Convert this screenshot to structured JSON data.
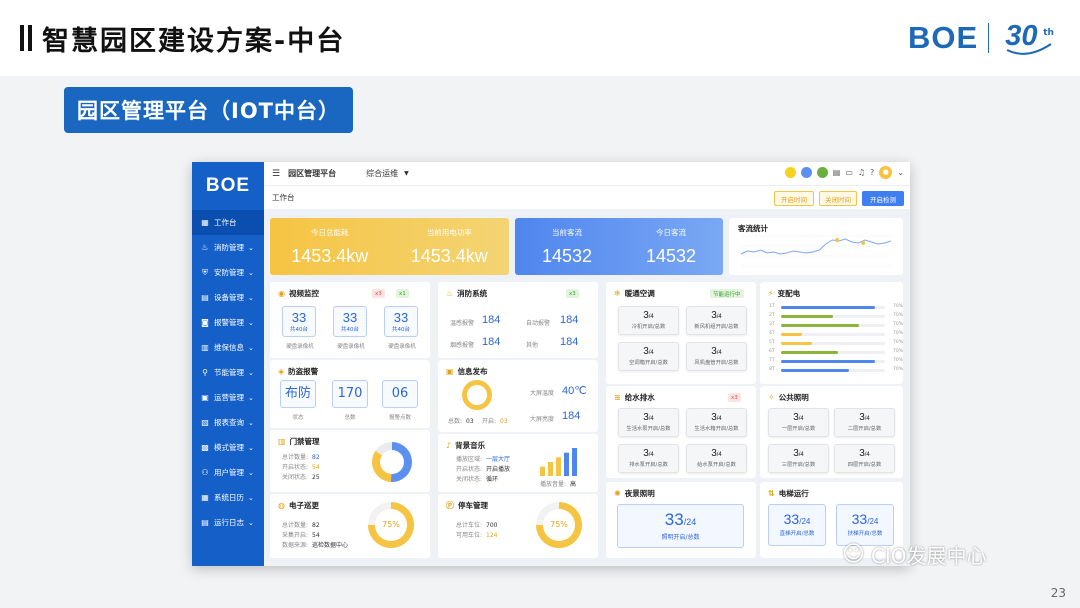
{
  "slide": {
    "title": "智慧园区建设方案-中台",
    "brand": "BOE",
    "anniversary": {
      "number": "30",
      "suffix": "th"
    },
    "section_tag": "园区管理平台（IOT中台）",
    "page_number": "23",
    "watermark": "CIO发展中心"
  },
  "colors": {
    "primary": "#1560c8",
    "accent_yellow": "#f6c443",
    "accent_blue": "#4f86ee",
    "value_blue": "#2c66d8",
    "green": "#8bb43a",
    "gray_donut": "#9aa4b8"
  },
  "sidebar": {
    "logo": "BOE",
    "items": [
      {
        "label": "工作台",
        "icon": "workbench-icon",
        "active": true,
        "chev": false
      },
      {
        "label": "消防管理",
        "icon": "fire-icon",
        "chev": true
      },
      {
        "label": "安防管理",
        "icon": "shield-icon",
        "chev": true
      },
      {
        "label": "设备管理",
        "icon": "device-icon",
        "chev": true
      },
      {
        "label": "报警管理",
        "icon": "alarm-icon",
        "chev": true
      },
      {
        "label": "维保信息",
        "icon": "maintenance-icon",
        "chev": true
      },
      {
        "label": "节能管理",
        "icon": "energy-icon",
        "chev": true
      },
      {
        "label": "运营管理",
        "icon": "operation-icon",
        "chev": true
      },
      {
        "label": "报表查询",
        "icon": "report-icon",
        "chev": true
      },
      {
        "label": "模式管理",
        "icon": "mode-icon",
        "chev": true
      },
      {
        "label": "用户管理",
        "icon": "user-icon",
        "chev": true
      },
      {
        "label": "系统日历",
        "icon": "calendar-icon",
        "chev": true
      },
      {
        "label": "运行日志",
        "icon": "log-icon",
        "chev": true
      }
    ]
  },
  "topbar": {
    "menu_icon": "menu-icon",
    "platform": "园区管理平台",
    "ops": "综合运维",
    "status_dots": [
      "#f6d21e",
      "#5b8ff0",
      "#6ab03f"
    ],
    "icons": [
      "doc-icon",
      "message-icon",
      "bell-icon",
      "help-icon",
      "avatar-icon"
    ]
  },
  "crumb": {
    "label": "工作台",
    "buttons": {
      "start_time": "开启时间",
      "close_time": "关闭时间",
      "start_check": "开启检测"
    }
  },
  "kpi": {
    "energy": [
      {
        "label": "今日总能耗",
        "value": "1453.4kw"
      },
      {
        "label": "当前用电功率",
        "value": "1453.4kw"
      }
    ],
    "flow": [
      {
        "label": "当前客流",
        "value": "14532"
      },
      {
        "label": "今日客流",
        "value": "14532"
      }
    ]
  },
  "visitor_stats": {
    "title": "客流统计"
  },
  "video": {
    "title": "视频监控",
    "badge_red": "x3",
    "badge_green": "x1",
    "items": [
      {
        "value": "33",
        "sub": "共40台",
        "label": "硬盘录像机"
      },
      {
        "value": "33",
        "sub": "共40台",
        "label": "硬盘录像机"
      },
      {
        "value": "33",
        "sub": "共40台",
        "label": "硬盘录像机"
      }
    ]
  },
  "theft": {
    "title": "防盗报警",
    "items": [
      {
        "value": "布防",
        "label": "状态"
      },
      {
        "value": "170",
        "label": "总数"
      },
      {
        "value": "06",
        "label": "报警点数"
      }
    ]
  },
  "access": {
    "title": "门禁管理",
    "rows": [
      {
        "k": "总计数量:",
        "v": "82",
        "c": "blue"
      },
      {
        "k": "开启状态:",
        "v": "54",
        "c": "orange"
      },
      {
        "k": "关闭状态:",
        "v": "25",
        "c": "dark"
      }
    ]
  },
  "patrol": {
    "title": "电子巡更",
    "rows": [
      {
        "k": "总计数量:",
        "v": "82"
      },
      {
        "k": "采集开启:",
        "v": "54"
      },
      {
        "k": "数据来源:",
        "v": "巡检数据中心"
      }
    ],
    "percent": "75%"
  },
  "fire": {
    "title": "消防系统",
    "badge": "x3",
    "items": [
      {
        "k": "温感报警",
        "v": "184"
      },
      {
        "k": "自动报警",
        "v": "184"
      },
      {
        "k": "烟感报警",
        "v": "184"
      },
      {
        "k": "其他",
        "v": "184"
      }
    ]
  },
  "info": {
    "title": "信息发布",
    "total_label": "总数:",
    "total": "03",
    "open_label": "开启:",
    "open": "03",
    "screen_temp_label": "大屏温度",
    "screen_temp": "40℃",
    "screen_bright_label": "大屏亮度",
    "screen_bright": "184"
  },
  "music": {
    "title": "背景音乐",
    "rows": [
      {
        "k": "播放区域:",
        "v": "一层大厅"
      },
      {
        "k": "开启状态:",
        "v": "开启播放"
      },
      {
        "k": "关闭状态:",
        "v": "循环"
      }
    ],
    "volume_label": "播放音量:",
    "volume": "高"
  },
  "parking": {
    "title": "停车管理",
    "rows": [
      {
        "k": "总计车位:",
        "v": "700"
      },
      {
        "k": "可用车位:",
        "v": "124"
      }
    ],
    "percent": "75%"
  },
  "hvac": {
    "title": "暖通空调",
    "badge": "节能运行中",
    "items": [
      {
        "v": "3",
        "d": "/4",
        "l": "冷机开启/总数"
      },
      {
        "v": "3",
        "d": "/4",
        "l": "新风机组开启/总数"
      },
      {
        "v": "3",
        "d": "/4",
        "l": "空调箱开启/总数"
      },
      {
        "v": "3",
        "d": "/4",
        "l": "风机盘管开启/总数"
      }
    ]
  },
  "power": {
    "title": "变配电",
    "percent_label": "70%",
    "bars": [
      {
        "n": "1T",
        "p": 0.9,
        "c": "#4f86ee"
      },
      {
        "n": "2T",
        "p": 0.5,
        "c": "#8bb43a"
      },
      {
        "n": "3T",
        "p": 0.75,
        "c": "#8bb43a"
      },
      {
        "n": "4T",
        "p": 0.2,
        "c": "#f6c443"
      },
      {
        "n": "5T",
        "p": 0.3,
        "c": "#f6c443"
      },
      {
        "n": "6T",
        "p": 0.55,
        "c": "#8bb43a"
      },
      {
        "n": "7T",
        "p": 0.9,
        "c": "#4f86ee"
      },
      {
        "n": "8T",
        "p": 0.65,
        "c": "#4f86ee"
      }
    ]
  },
  "water": {
    "title": "给水排水",
    "badge": "x3",
    "items": [
      {
        "v": "3",
        "d": "/4",
        "l": "生活水泵开启/总数"
      },
      {
        "v": "3",
        "d": "/4",
        "l": "生活水箱开启/总数"
      },
      {
        "v": "3",
        "d": "/4",
        "l": "排水泵开启/总数"
      },
      {
        "v": "3",
        "d": "/4",
        "l": "给水泵开启/总数"
      }
    ]
  },
  "lighting": {
    "title": "公共照明",
    "items": [
      {
        "v": "3",
        "d": "/4",
        "l": "一层开启/总数"
      },
      {
        "v": "3",
        "d": "/4",
        "l": "二层开启/总数"
      },
      {
        "v": "3",
        "d": "/4",
        "l": "三层开启/总数"
      },
      {
        "v": "3",
        "d": "/4",
        "l": "四层开启/总数"
      }
    ]
  },
  "night": {
    "title": "夜景照明",
    "v": "33",
    "d": "/24",
    "l": "照明开启/总数"
  },
  "elevator": {
    "title": "电梯运行",
    "items": [
      {
        "v": "33",
        "d": "/24",
        "l": "直梯开启/总数"
      },
      {
        "v": "33",
        "d": "/24",
        "l": "扶梯开启/总数"
      }
    ]
  },
  "chart_data": [
    {
      "type": "line",
      "title": "客流统计",
      "values": [
        12,
        15,
        14,
        16,
        13,
        14,
        12,
        13,
        15,
        14,
        13,
        14,
        16,
        22,
        26,
        25,
        27,
        24,
        23,
        26,
        24,
        22,
        23,
        25
      ],
      "points": [
        4,
        8
      ],
      "ylim": [
        0,
        30
      ]
    },
    {
      "type": "pie",
      "title": "门禁管理",
      "values": [
        82,
        54,
        25
      ]
    },
    {
      "type": "bar",
      "title": "背景音乐",
      "values": [
        2,
        3,
        4,
        5,
        6
      ],
      "colors": [
        "#f6c443",
        "#f6c443",
        "#f6c443",
        "#4f86ee",
        "#4f86ee"
      ]
    }
  ]
}
